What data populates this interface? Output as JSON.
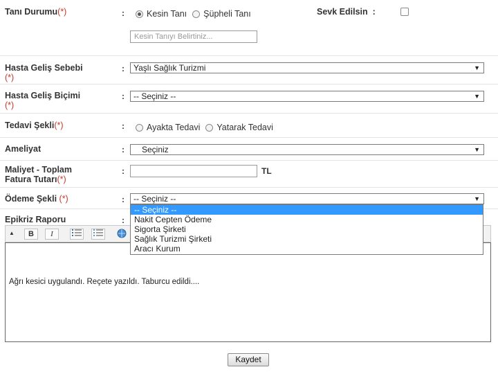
{
  "form": {
    "tani_durumu": {
      "label": "Tanı Durumu",
      "req": "(*)",
      "options": [
        "Kesin Tanı",
        "Şüpheli Tanı"
      ],
      "selected_index": 0,
      "input_placeholder": "Kesin Tanıyı Belirtiniz..."
    },
    "sevk": {
      "label": "Sevk Edilsin",
      "colon": ":",
      "checked": false
    },
    "hasta_gelis_sebebi": {
      "label": "Hasta Geliş Sebebi",
      "req": "(*)",
      "value": "Yaşlı Sağlık Turizmi"
    },
    "hasta_gelis_bicimi": {
      "label": "Hasta Geliş Biçimi",
      "req": "(*)",
      "value": "-- Seçiniz --"
    },
    "tedavi_sekli": {
      "label": "Tedavi Şekli",
      "req": "(*)",
      "options": [
        "Ayakta Tedavi",
        "Yatarak Tedavi"
      ]
    },
    "ameliyat": {
      "label": "Ameliyat",
      "value": "Seçiniz"
    },
    "maliyet": {
      "label_line1": "Maliyet - Toplam",
      "label_line2": "Fatura Tutarı",
      "req": "(*)",
      "unit": "TL"
    },
    "odeme_sekli": {
      "label": "Ödeme Şekli",
      "req": "(*)",
      "value": "-- Seçiniz --",
      "options": [
        "-- Seçiniz --",
        "Nakit Cepten Ödeme",
        "Sigorta Şirketi",
        "Sağlık Turizmi Şirketi",
        "Aracı Kurum"
      ]
    },
    "epikriz": {
      "label": "Epikriz Raporu",
      "content": "Ağrı kesici uygulandı. Reçete yazıldı. Taburcu edildi...."
    },
    "colon": ":",
    "save_label": "Kaydet"
  },
  "toolbar": {
    "bold": "B",
    "italic": "I",
    "ol_icon": "ordered-list-icon",
    "ul_icon": "unordered-list-icon",
    "link_icon": "globe-link-icon"
  },
  "icons": {
    "dropdown_arrow": "▼"
  },
  "colors": {
    "required": "#c0392b",
    "highlight": "#3399ff"
  }
}
